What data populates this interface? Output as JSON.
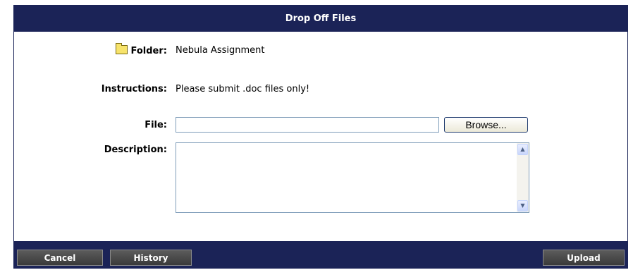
{
  "title": "Drop Off Files",
  "folder": {
    "label": "Folder:",
    "value": "Nebula Assignment",
    "icon": "folder-icon"
  },
  "instructions": {
    "label": "Instructions:",
    "value": "Please submit .doc files only!"
  },
  "file": {
    "label": "File:",
    "value": "",
    "browse_label": "Browse..."
  },
  "description": {
    "label": "Description:",
    "value": ""
  },
  "footer": {
    "cancel_label": "Cancel",
    "history_label": "History",
    "upload_label": "Upload"
  },
  "colors": {
    "bar": "#1b2357",
    "button": "#4a4a4a"
  }
}
